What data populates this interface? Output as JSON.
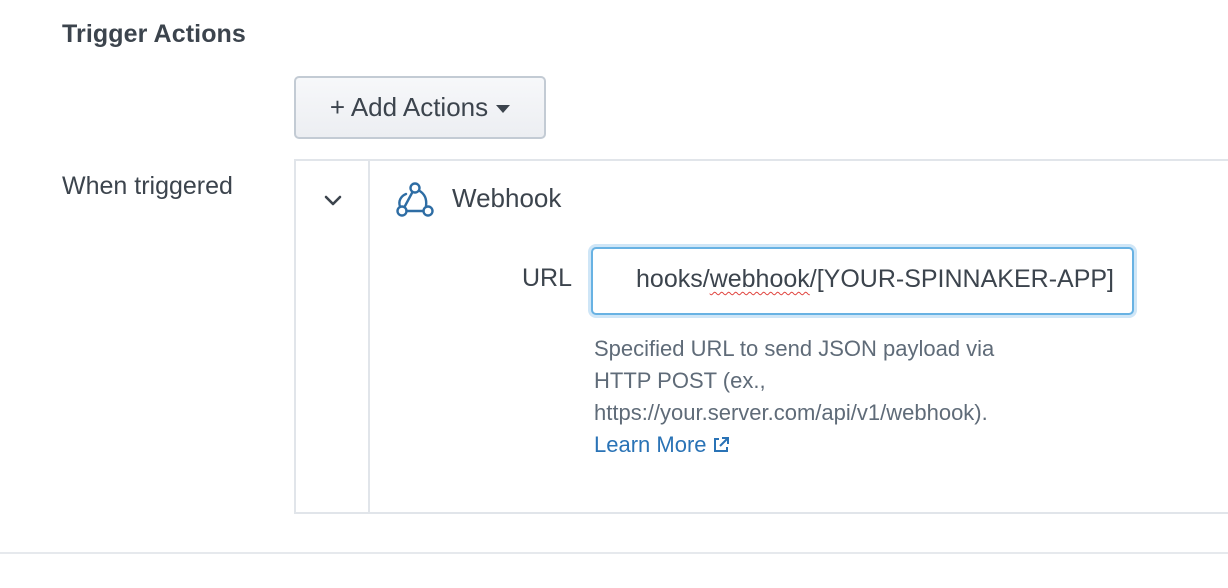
{
  "section": {
    "title": "Trigger Actions"
  },
  "add_actions": {
    "label": "+ Add Actions"
  },
  "row": {
    "label": "When triggered"
  },
  "action": {
    "expanded": true,
    "icon": "webhook-icon",
    "title": "Webhook",
    "url": {
      "label": "URL",
      "value_prefix": "hooks/",
      "value_misspelled": "webhook",
      "value_suffix": "/[YOUR-SPINNAKER-APP]"
    },
    "help": {
      "line1": "Specified URL to send JSON payload via",
      "line2": "HTTP POST (ex.,",
      "line3": "https://your.server.com/api/v1/webhook).",
      "learn_more": "Learn More"
    }
  },
  "colors": {
    "link": "#2a73b6",
    "focus_border": "#68b2e3",
    "text": "#3c444d",
    "muted_text": "#5f6b78"
  }
}
